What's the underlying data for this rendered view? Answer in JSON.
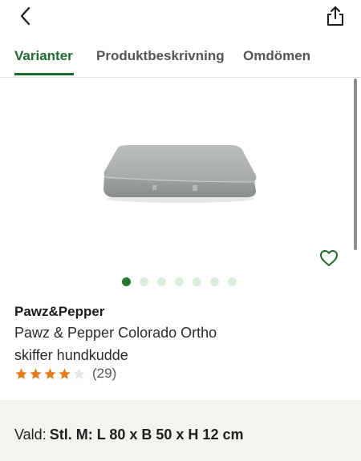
{
  "header": {
    "back_icon": "chevron-left-icon",
    "share_icon": "share-icon"
  },
  "tabs": [
    {
      "label": "Varianter",
      "active": true
    },
    {
      "label": "Produktbeskrivning",
      "active": false
    },
    {
      "label": "Omdömen",
      "active": false
    }
  ],
  "gallery": {
    "image_count": 7,
    "current_index": 0,
    "favorite_icon": "heart-outline-icon"
  },
  "product": {
    "brand": "Pawz&Pepper",
    "title": "Pawz & Pepper Colorado Ortho skiffer hundkudde",
    "rating": 4,
    "rating_max": 5,
    "review_count": "(29)"
  },
  "variant": {
    "label": "Vald:",
    "value": "Stl. M: L 80 x B 50 x H 12 cm"
  },
  "colors": {
    "accent_green": "#1f6b2c",
    "dot_inactive": "#dbeedd",
    "star_filled": "#e27d1c",
    "star_empty": "#e6e6e6",
    "variant_bar_bg": "#f5f3ee"
  }
}
